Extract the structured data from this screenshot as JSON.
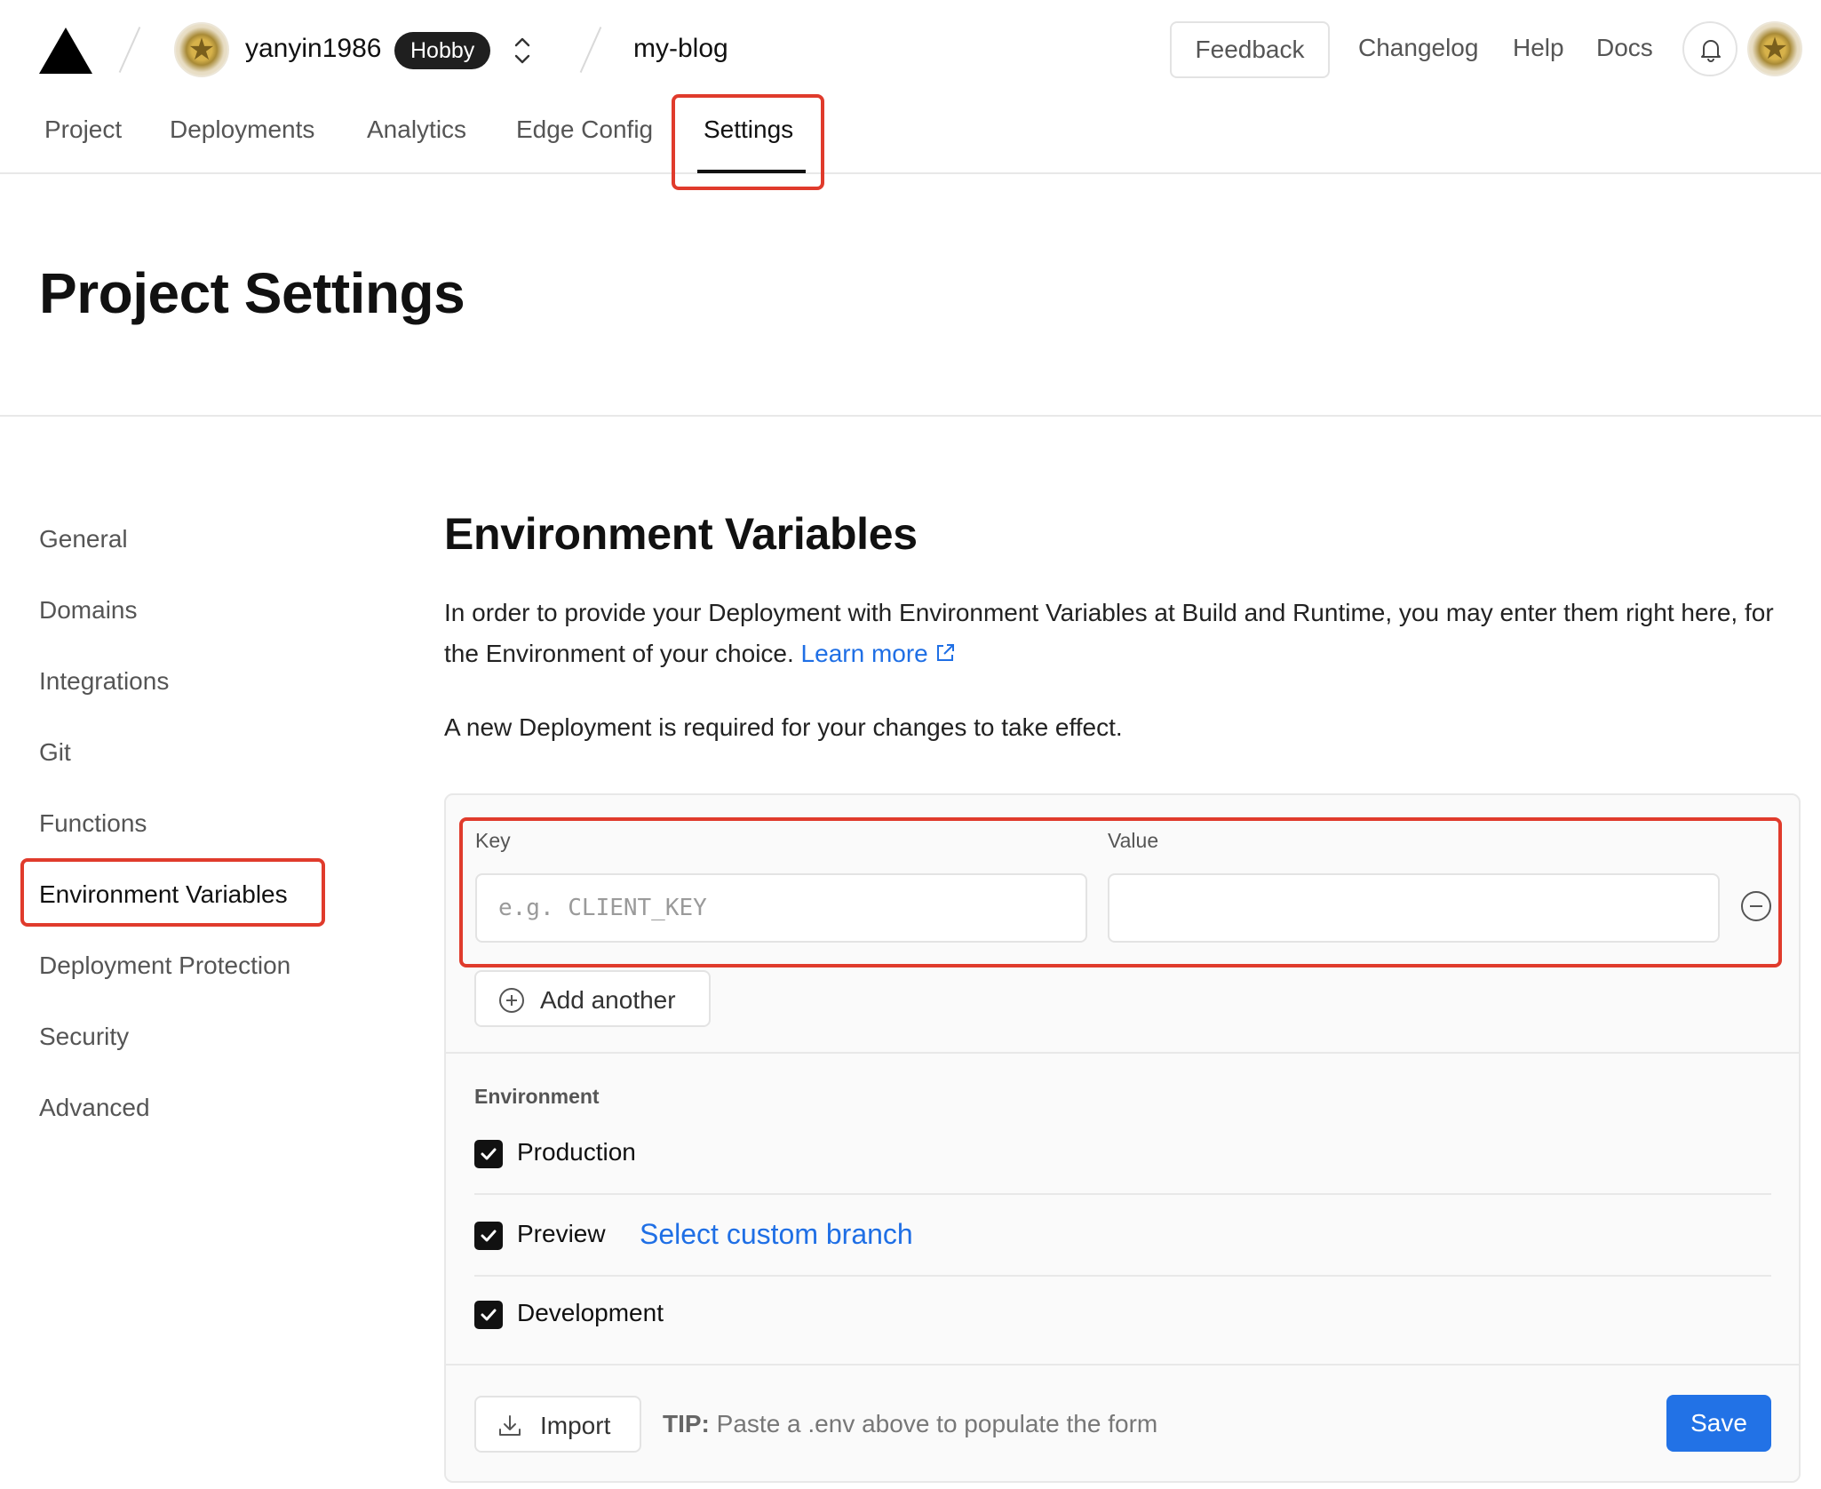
{
  "header": {
    "team_name": "yanyin1986",
    "plan_badge": "Hobby",
    "project_name": "my-blog",
    "feedback_label": "Feedback",
    "links": [
      "Changelog",
      "Help",
      "Docs"
    ]
  },
  "tabs": [
    {
      "label": "Project"
    },
    {
      "label": "Deployments"
    },
    {
      "label": "Analytics"
    },
    {
      "label": "Edge Config"
    },
    {
      "label": "Settings",
      "active": true
    }
  ],
  "page": {
    "title": "Project Settings"
  },
  "sidebar": {
    "items": [
      {
        "label": "General"
      },
      {
        "label": "Domains"
      },
      {
        "label": "Integrations"
      },
      {
        "label": "Git"
      },
      {
        "label": "Functions"
      },
      {
        "label": "Environment Variables",
        "active": true
      },
      {
        "label": "Deployment Protection"
      },
      {
        "label": "Security"
      },
      {
        "label": "Advanced"
      }
    ]
  },
  "main": {
    "title": "Environment Variables",
    "description": "In order to provide your Deployment with Environment Variables at Build and Runtime, you may enter them right here, for the Environment of your choice.",
    "learn_more": "Learn more",
    "notice": "A new Deployment is required for your changes to take effect.",
    "form": {
      "key_label": "Key",
      "value_label": "Value",
      "key_placeholder": "e.g. CLIENT_KEY",
      "key_value": "",
      "value_value": "",
      "add_another": "Add another",
      "environment_label": "Environment",
      "environments": [
        {
          "name": "Production",
          "checked": true
        },
        {
          "name": "Preview",
          "checked": true,
          "link": "Select custom branch"
        },
        {
          "name": "Development",
          "checked": true
        }
      ],
      "import_label": "Import",
      "tip_prefix": "TIP:",
      "tip_text": " Paste a .env above to populate the form",
      "save_label": "Save"
    }
  },
  "colors": {
    "accent_blue": "#2272e6",
    "link_blue": "#1f6fe5",
    "highlight_red": "#e03b2c"
  },
  "icons": [
    "vercel-logo-icon",
    "avatar-icon",
    "chevron-up-down-icon",
    "bell-icon",
    "external-link-icon",
    "minus-circle-icon",
    "plus-circle-icon",
    "check-icon",
    "download-icon"
  ]
}
